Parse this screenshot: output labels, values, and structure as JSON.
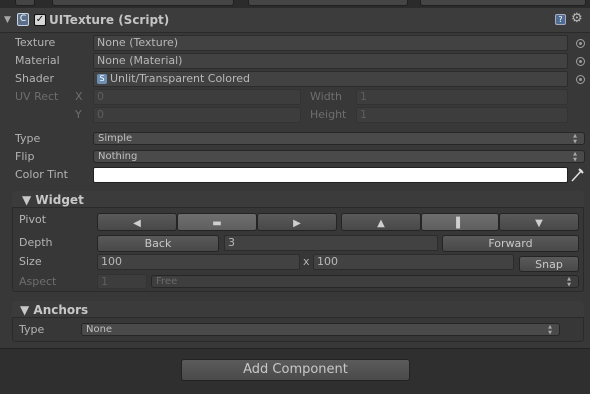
{
  "header": {
    "foldout": "▼",
    "script_icon": "C",
    "enabled_check": "✓",
    "title": "UITexture (Script)",
    "help_icon": "?",
    "settings_icon": "⚙"
  },
  "texture": {
    "label": "Texture",
    "value": "None (Texture)"
  },
  "material": {
    "label": "Material",
    "value": "None (Material)"
  },
  "shader": {
    "label": "Shader",
    "value": "Unlit/Transparent Colored",
    "icon": "S"
  },
  "uv_rect": {
    "label": "UV Rect",
    "x_label": "X",
    "x_value": "0",
    "y_label": "Y",
    "y_value": "0",
    "width_label": "Width",
    "width_value": "1",
    "height_label": "Height",
    "height_value": "1"
  },
  "type": {
    "label": "Type",
    "value": "Simple"
  },
  "flip": {
    "label": "Flip",
    "value": "Nothing"
  },
  "color_tint": {
    "label": "Color Tint",
    "color": "#ffffff",
    "eyedropper_icon": "eyedropper-icon"
  },
  "widget": {
    "title": "▼ Widget",
    "pivot_label": "Pivot",
    "pivot_h": [
      "◀",
      "▬",
      "▶"
    ],
    "pivot_v": [
      "▲",
      "▌",
      "▼"
    ],
    "depth_label": "Depth",
    "back_label": "Back",
    "depth_value": "3",
    "forward_label": "Forward",
    "size_label": "Size",
    "size_w": "100",
    "size_x": "x",
    "size_h": "100",
    "snap_label": "Snap",
    "aspect_label": "Aspect",
    "aspect_value": "1",
    "aspect_mode": "Free"
  },
  "anchors": {
    "title": "▼ Anchors",
    "type_label": "Type",
    "type_value": "None"
  },
  "add_component_label": "Add Component",
  "dropdown_arrows": "▲▼"
}
